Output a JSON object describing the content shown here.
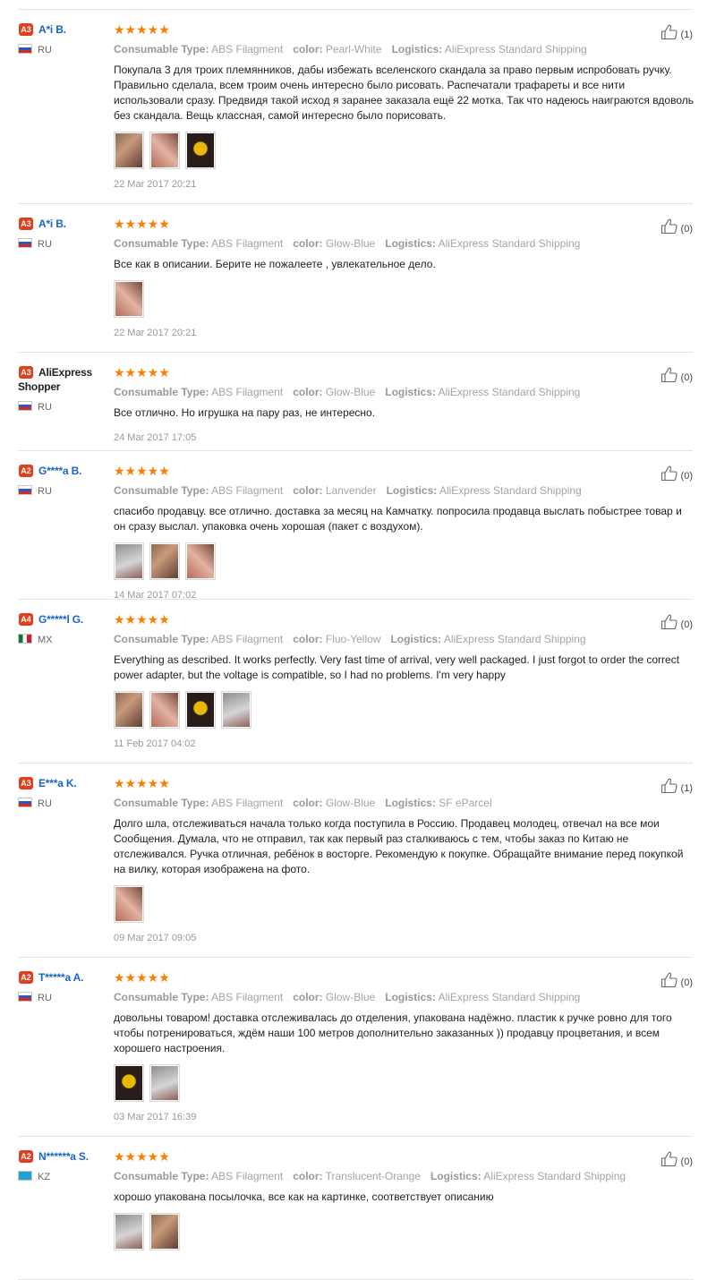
{
  "labels": {
    "consumable_type": "Consumable Type:",
    "color": "color:",
    "logistics": "Logistics:"
  },
  "stars": "★★★★★",
  "rating_stars": 5,
  "accent": {
    "badge": "#e0401c",
    "star": "#f97e02",
    "name": "#1a64c6"
  },
  "reviews": [
    {
      "level": "A3",
      "name": "A*i B.",
      "name_style": "link",
      "country": "RU",
      "consumable_type": "ABS Filagment",
      "color": "Pearl-White",
      "logistics": "AliExpress Standard Shipping",
      "text": "Покупала 3 для троих племянников, дабы избежать вселенского скандала за право первым испробовать ручку. Правильно сделала, всем троим очень интересно было рисовать. Распечатали трафареты и все нити использовали сразу. Предвидя такой исход я заранее заказала ещё 22 мотка. Так что надеюсь наиграются вдоволь без скандала. Вещь классная, самой интересно было порисовать.",
      "photos": [
        "photo-1",
        "photo-2",
        "photo-3"
      ],
      "date": "22 Mar 2017 20:21",
      "helpful": "(1)"
    },
    {
      "level": "A3",
      "name": "A*i B.",
      "name_style": "link",
      "country": "RU",
      "consumable_type": "ABS Filagment",
      "color": "Glow-Blue",
      "logistics": "AliExpress Standard Shipping",
      "text": "Все как в описании. Берите не пожалеете , увлекательное дело.",
      "photos": [
        "photo-1"
      ],
      "date": "22 Mar 2017 20:21",
      "helpful": "(0)"
    },
    {
      "level": "A3",
      "name": "AliExpress Shopper",
      "name_style": "plain",
      "country": "RU",
      "consumable_type": "ABS Filagment",
      "color": "Glow-Blue",
      "logistics": "AliExpress Standard Shipping",
      "text": "Все отлично. Но игрушка на пару раз, не интересно.",
      "photos": [],
      "date": "24 Mar 2017 17:05",
      "helpful": "(0)"
    },
    {
      "level": "A2",
      "name": "G****a B.",
      "name_style": "link",
      "country": "RU",
      "consumable_type": "ABS Filagment",
      "color": "Lanvender",
      "logistics": "AliExpress Standard Shipping",
      "text": "спасибо продавцу. все отлично. доставка за месяц на Камчатку. попросила продавца выслать побыстрее товар и он сразу выслал. упаковка очень хорошая (пакет с воздухом).",
      "photos": [
        "photo-1",
        "photo-2",
        "photo-3"
      ],
      "date": "14 Mar 2017 07:02",
      "helpful": "(0)"
    },
    {
      "level": "A4",
      "name": "G*****l G.",
      "name_style": "link",
      "country": "MX",
      "consumable_type": "ABS Filagment",
      "color": "Fluo-Yellow",
      "logistics": "AliExpress Standard Shipping",
      "text": "Everything as described. It works perfectly. Very fast time of arrival, very well packaged. I just forgot to order the correct power adapter, but the voltage is compatible, so I had no problems. I'm very happy",
      "photos": [
        "photo-1",
        "photo-2",
        "photo-3",
        "photo-4"
      ],
      "date": "11 Feb 2017 04:02",
      "helpful": "(0)"
    },
    {
      "level": "A3",
      "name": "E***a K.",
      "name_style": "link",
      "country": "RU",
      "consumable_type": "ABS Filagment",
      "color": "Glow-Blue",
      "logistics": "SF eParcel",
      "text": "Долго шла, отслеживаться начала только когда поступила в Россию. Продавец молодец, отвечал на все мои Сообщения. Думала, что не отправил, так как первый раз сталкиваюсь с тем, чтобы заказ по Китаю не отслеживался. Ручка отличная, ребёнок в восторге. Рекомендую к покупке. Обращайте внимание перед покупкой на вилку, которая изображена на фото.",
      "photos": [
        "photo-1"
      ],
      "date": "09 Mar 2017 09:05",
      "helpful": "(1)"
    },
    {
      "level": "A2",
      "name": "T*****a A.",
      "name_style": "link",
      "country": "RU",
      "consumable_type": "ABS Filagment",
      "color": "Glow-Blue",
      "logistics": "AliExpress Standard Shipping",
      "text": "довольны товаром! доставка отслеживалась до отделения, упакована надёжно. пластик к ручке ровно для того чтобы потренироваться, ждём наши 100 метров дополнительно заказанных )) продавцу процветания, и всем хорошего настроения.",
      "photos": [
        "photo-1",
        "photo-2"
      ],
      "date": "03 Mar 2017 16:39",
      "helpful": "(0)"
    },
    {
      "level": "A2",
      "name": "N******a S.",
      "name_style": "link",
      "country": "KZ",
      "consumable_type": "ABS Filagment",
      "color": "Translucent-Orange",
      "logistics": "AliExpress Standard Shipping",
      "text": "хорошо упакована посылочка, все как на картинке, соответствует описанию",
      "photos": [
        "photo-1",
        "photo-2"
      ],
      "date": "",
      "helpful": "(0)"
    }
  ]
}
